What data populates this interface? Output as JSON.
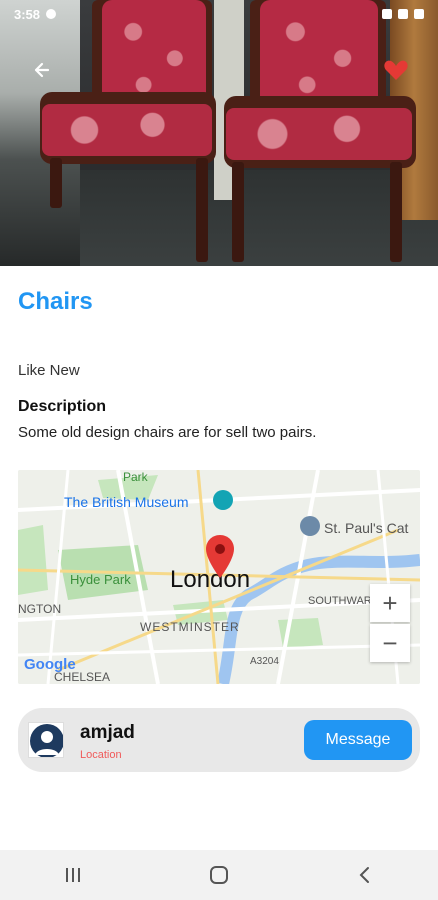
{
  "status_bar": {
    "time": "3:58"
  },
  "product": {
    "title": "Chairs",
    "condition": "Like New",
    "description_label": "Description",
    "description": "Some old design chairs are for sell two pairs."
  },
  "map": {
    "city_label": "London",
    "places": [
      "The British Museum",
      "St. Paul's Cat",
      "Hyde Park",
      "WESTMINSTER",
      "SOUTHWAR",
      "NGTON",
      "CHELSEA",
      "Park",
      "A3204"
    ],
    "zoom_in_label": "+",
    "zoom_out_label": "−",
    "attribution": "Google"
  },
  "seller": {
    "name": "amjad",
    "location_label": "Location",
    "message_button": "Message"
  },
  "colors": {
    "accent": "#2196f3",
    "favorite": "#e53935",
    "location_text": "#f05a5a"
  },
  "icons": [
    "back-arrow-icon",
    "heart-icon",
    "map-pin-icon",
    "museum-icon",
    "church-icon",
    "avatar-icon",
    "recents-icon",
    "home-icon",
    "back-nav-icon"
  ]
}
